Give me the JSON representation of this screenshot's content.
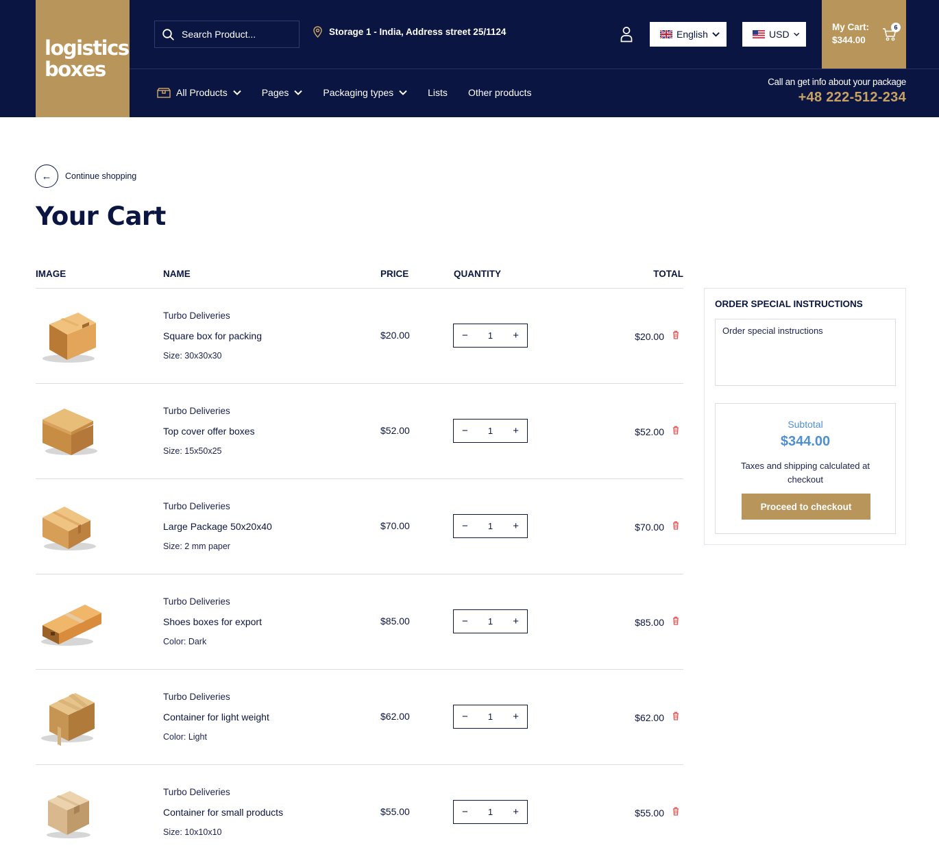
{
  "brand": {
    "line1": "logistics",
    "line2": "boxes"
  },
  "search": {
    "placeholder": "Search Product..."
  },
  "location": {
    "text": "Storage 1 - India, Address street 25/1124"
  },
  "language": {
    "selected": "English"
  },
  "currency": {
    "selected": "USD"
  },
  "cart": {
    "label": "My Cart:",
    "amount": "$344.00",
    "count": "6"
  },
  "nav": {
    "items": [
      {
        "label": "All Products"
      },
      {
        "label": "Pages"
      },
      {
        "label": "Packaging types"
      },
      {
        "label": "Lists"
      },
      {
        "label": "Other products"
      }
    ]
  },
  "contact": {
    "text": "Call an get info about your package",
    "phone": "+48 222-512-234"
  },
  "page": {
    "back_label": "Continue shopping",
    "back_icon": "←",
    "title": "Your Cart"
  },
  "table": {
    "headers": {
      "image": "IMAGE",
      "name": "NAME",
      "price": "PRICE",
      "quantity": "QUANTITY",
      "total": "TOTAL"
    },
    "rows": [
      {
        "vendor": "Turbo Deliveries",
        "name": "Square box for packing",
        "attr_label": "Size:",
        "attr_value": "30x30x30",
        "price": "$20.00",
        "qty": "1",
        "total": "$20.00"
      },
      {
        "vendor": "Turbo Deliveries",
        "name": "Top cover offer boxes",
        "attr_label": "Size:",
        "attr_value": "15x50x25",
        "price": "$52.00",
        "qty": "1",
        "total": "$52.00"
      },
      {
        "vendor": "Turbo Deliveries",
        "name": "Large Package 50x20x40",
        "attr_label": "Size:",
        "attr_value": "2 mm paper",
        "price": "$70.00",
        "qty": "1",
        "total": "$70.00"
      },
      {
        "vendor": "Turbo Deliveries",
        "name": "Shoes boxes for export",
        "attr_label": "Color:",
        "attr_value": "Dark",
        "price": "$85.00",
        "qty": "1",
        "total": "$85.00"
      },
      {
        "vendor": "Turbo Deliveries",
        "name": "Container for light weight",
        "attr_label": "Color:",
        "attr_value": "Light",
        "price": "$62.00",
        "qty": "1",
        "total": "$62.00"
      },
      {
        "vendor": "Turbo Deliveries",
        "name": "Container for small products",
        "attr_label": "Size:",
        "attr_value": "10x10x10",
        "price": "$55.00",
        "qty": "1",
        "total": "$55.00"
      }
    ]
  },
  "qty_controls": {
    "minus": "−",
    "plus": "+"
  },
  "sidebar": {
    "title": "ORDER SPECIAL INSTRUCTIONS",
    "instructions_placeholder": "Order special instructions",
    "subtotal_label": "Subtotal",
    "subtotal_value": "$344.00",
    "tax_note": "Taxes and shipping calculated at checkout",
    "checkout_label": "Proceed to checkout"
  },
  "colors": {
    "navy": "#0b1542",
    "gold": "#b8955a",
    "phone": "#c8a265",
    "subtotal": "#4f8fd1",
    "trash": "#e05555"
  },
  "icons": [
    "search-icon",
    "location-pin-icon",
    "user-icon",
    "uk-flag-icon",
    "us-flag-icon",
    "chevron-down-icon",
    "cart-icon",
    "box-icon",
    "arrow-left-icon",
    "trash-icon",
    "cardboard-box-image"
  ]
}
